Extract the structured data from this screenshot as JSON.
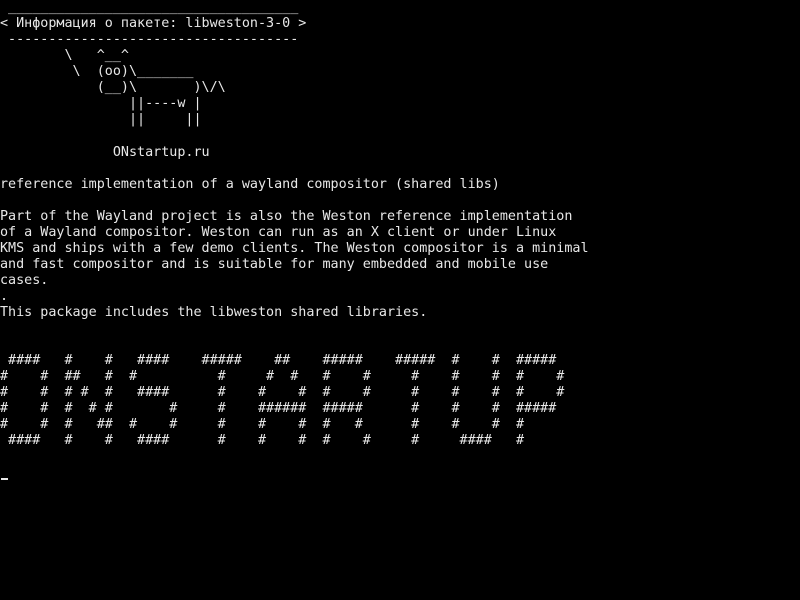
{
  "terminal": {
    "cowsay": {
      "border_top": " ____________________________________",
      "bubble": "< Информация о пакете: libweston-3-0 >",
      "border_bottom": " ------------------------------------",
      "cow": [
        "        \\   ^__^",
        "         \\  (oo)\\_______",
        "            (__)\\       )\\/\\",
        "                ||----w |",
        "                ||     ||"
      ],
      "site": "              ONstartup.ru"
    },
    "summary": "reference implementation of a wayland compositor (shared libs)",
    "description": [
      "Part of the Wayland project is also the Weston reference implementation",
      "of a Wayland compositor. Weston can run as an X client or under Linux",
      "KMS and ships with a few demo clients. The Weston compositor is a minimal",
      "and fast compositor and is suitable for many embedded and mobile use",
      "cases.",
      ".",
      "This package includes the libweston shared libraries."
    ],
    "banner": [
      " ####   #    #   ####    #####    ##    #####    #####  #    #  #####",
      "#    #  ##   #  #          #     #  #   #    #     #    #    #  #    #",
      "#    #  # #  #   ####      #    #    #  #    #     #    #    #  #    #",
      "#    #  #  # #       #     #    ######  #####      #    #    #  #####",
      "#    #  #   ##  #    #     #    #    #  #   #      #    #    #  #",
      " ####   #    #   ####      #    #    #  #    #     #     ####   #"
    ]
  }
}
